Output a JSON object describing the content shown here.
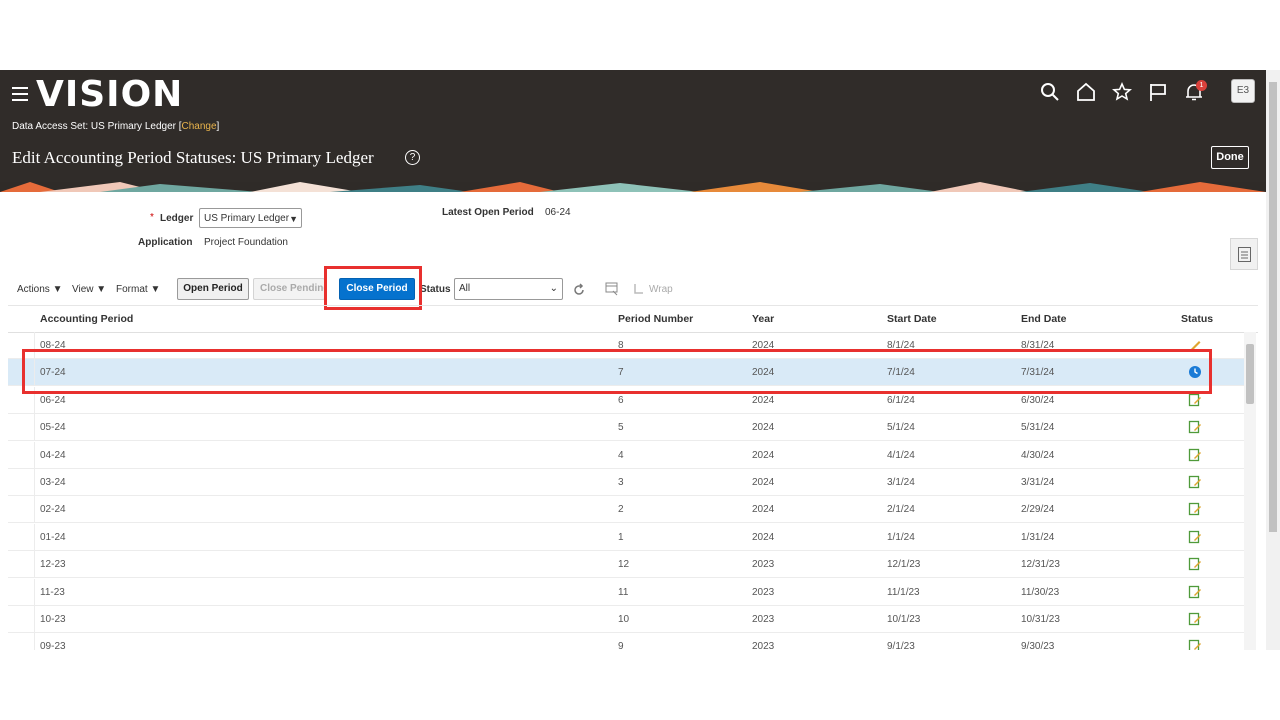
{
  "header": {
    "logo": "VISION",
    "data_access_label": "Data Access Set: US Primary Ledger [",
    "data_access_change": "Change",
    "data_access_close": "]",
    "page_title": "Edit Accounting Period Statuses: US Primary Ledger",
    "done_label": "Done",
    "avatar_initials": "E3",
    "notifications_count": "1",
    "icons": [
      "search-icon",
      "home-icon",
      "star-icon",
      "flag-icon",
      "bell-icon"
    ]
  },
  "form": {
    "ledger_required": "*",
    "ledger_label": "Ledger",
    "ledger_value": "US Primary Ledger",
    "application_label": "Application",
    "application_value": "Project Foundation",
    "latest_open_label": "Latest Open Period",
    "latest_open_value": "06-24"
  },
  "toolbar": {
    "actions": "Actions",
    "view": "View",
    "format": "Format",
    "open_period": "Open Period",
    "close_pending": "Close Pending",
    "close_period": "Close Period",
    "status_label": "Status",
    "status_value": "All",
    "wrap": "Wrap"
  },
  "table": {
    "columns": [
      "Accounting Period",
      "Period Number",
      "Year",
      "Start Date",
      "End Date",
      "Status"
    ],
    "rows": [
      {
        "period": "08-24",
        "number": "8",
        "year": "2024",
        "start": "8/1/24",
        "end": "8/31/24",
        "status": "future-entry-icon"
      },
      {
        "period": "07-24",
        "number": "7",
        "year": "2024",
        "start": "7/1/24",
        "end": "7/31/24",
        "status": "close-pending-icon",
        "selected": true
      },
      {
        "period": "06-24",
        "number": "6",
        "year": "2024",
        "start": "6/1/24",
        "end": "6/30/24",
        "status": "open-icon"
      },
      {
        "period": "05-24",
        "number": "5",
        "year": "2024",
        "start": "5/1/24",
        "end": "5/31/24",
        "status": "open-icon"
      },
      {
        "period": "04-24",
        "number": "4",
        "year": "2024",
        "start": "4/1/24",
        "end": "4/30/24",
        "status": "open-icon"
      },
      {
        "period": "03-24",
        "number": "3",
        "year": "2024",
        "start": "3/1/24",
        "end": "3/31/24",
        "status": "open-icon"
      },
      {
        "period": "02-24",
        "number": "2",
        "year": "2024",
        "start": "2/1/24",
        "end": "2/29/24",
        "status": "open-icon"
      },
      {
        "period": "01-24",
        "number": "1",
        "year": "2024",
        "start": "1/1/24",
        "end": "1/31/24",
        "status": "open-icon"
      },
      {
        "period": "12-23",
        "number": "12",
        "year": "2023",
        "start": "12/1/23",
        "end": "12/31/23",
        "status": "open-icon"
      },
      {
        "period": "11-23",
        "number": "11",
        "year": "2023",
        "start": "11/1/23",
        "end": "11/30/23",
        "status": "open-icon"
      },
      {
        "period": "10-23",
        "number": "10",
        "year": "2023",
        "start": "10/1/23",
        "end": "10/31/23",
        "status": "open-icon"
      },
      {
        "period": "09-23",
        "number": "9",
        "year": "2023",
        "start": "9/1/23",
        "end": "9/30/23",
        "status": "open-icon"
      }
    ]
  },
  "colors": {
    "header_bg": "#302c29",
    "primary_button": "#0572ce",
    "highlight": "#e8302e",
    "selected_row": "#d9eaf7"
  }
}
